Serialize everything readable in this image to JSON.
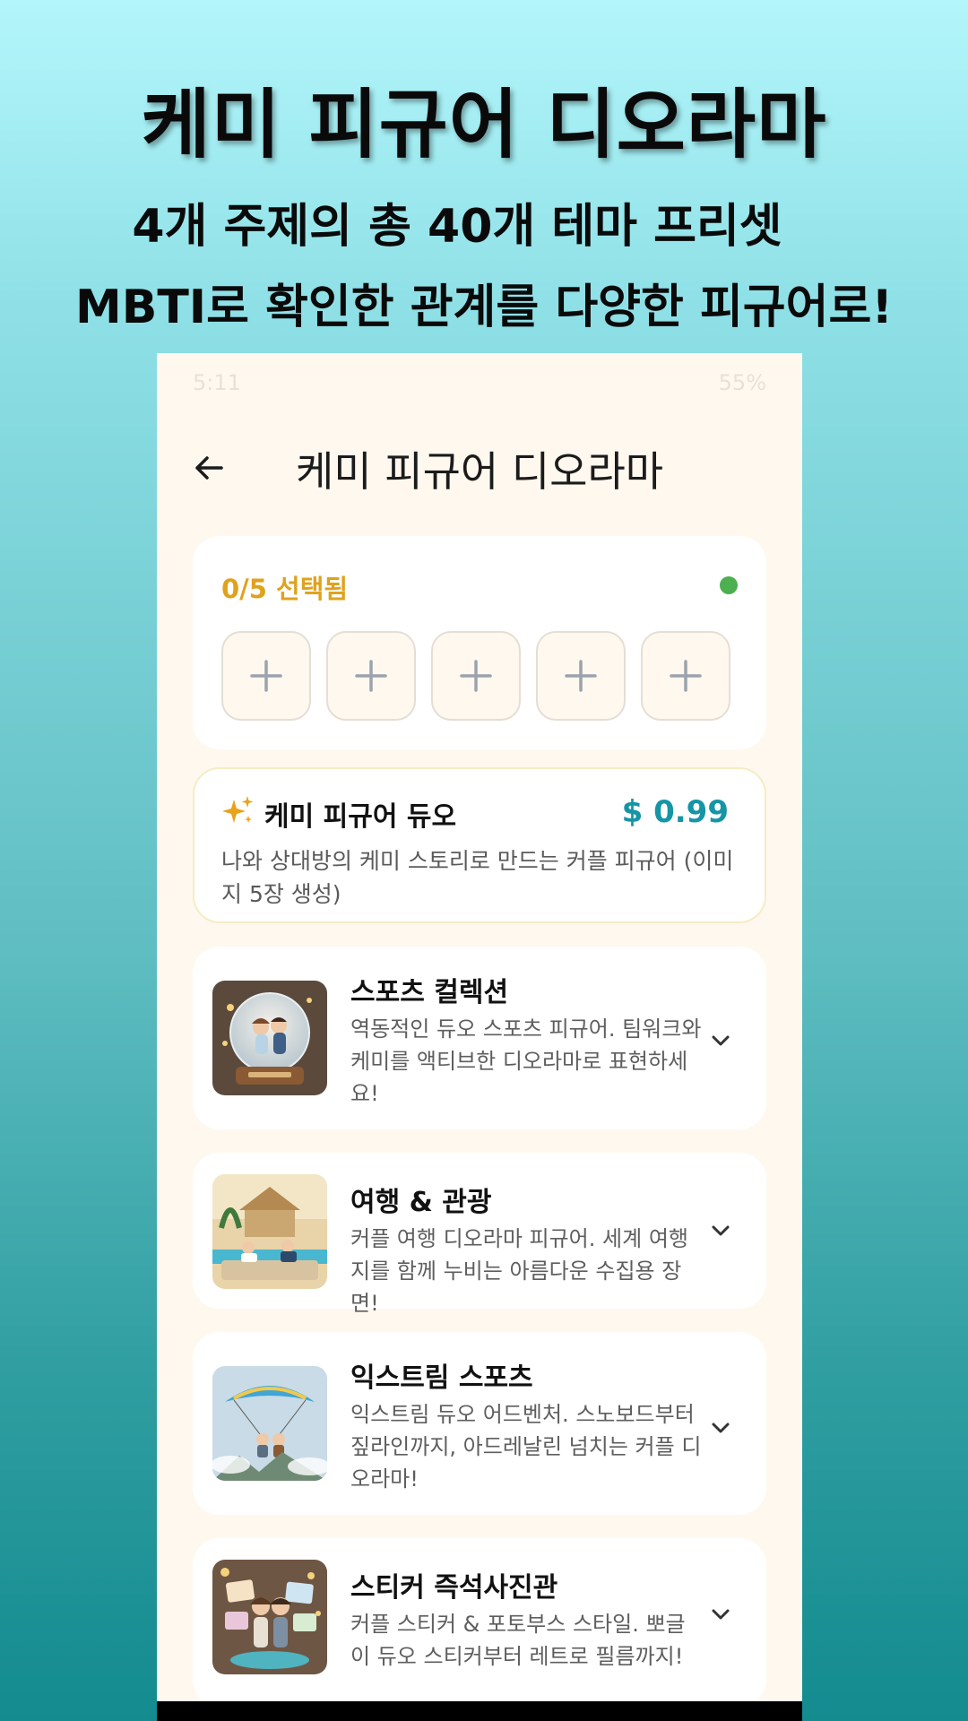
{
  "promo": {
    "title": "케미 피규어 디오라마",
    "line1": "4개 주제의 총 40개 테마 프리셋",
    "line2": "MBTI로 확인한 관계를 다양한 피규어로!"
  },
  "status_bar": {
    "time": "5:11",
    "battery": "55%"
  },
  "app_bar": {
    "back_icon": "arrow-left-icon",
    "title": "케미 피규어 디오라마"
  },
  "selection": {
    "label": "0/5 선택됨",
    "slot_icon": "plus-icon",
    "slot_count": 5,
    "dot_color": "#4caf50"
  },
  "duo": {
    "icon": "sparkle-icon",
    "title": "케미 피규어 듀오",
    "price": "$ 0.99",
    "description": "나와 상대방의 케미 스토리로 만드는 커플 피규어 (이미지 5장 생성)"
  },
  "categories": [
    {
      "title": "스포츠 컬렉션",
      "description": "역동적인 듀오 스포츠 피규어. 팀워크와 케미를 액티브한 디오라마로 표현하세요!",
      "image": "snow-globe-skating-couple"
    },
    {
      "title": "여행 & 관광",
      "description": "커플 여행 디오라마 피규어. 세계 여행지를 함께 누비는 아름다운 수집용 장면!",
      "image": "beach-resort-couple"
    },
    {
      "title": "익스트림 스포츠",
      "description": "익스트림 듀오 어드벤처. 스노보드부터 짚라인까지, 아드레날린 넘치는 커플 디오라마!",
      "image": "paragliding-couple"
    },
    {
      "title": "스티커 즉석사진관",
      "description": "커플 스티커 & 포토부스 스타일. 뽀글이 듀오 스티커부터 레트로 필름까지!",
      "image": "sticker-photobooth-couple"
    }
  ],
  "colors": {
    "accent_gold": "#e0a21c",
    "price_teal": "#1595a6",
    "screen_bg": "#fff8ef"
  }
}
